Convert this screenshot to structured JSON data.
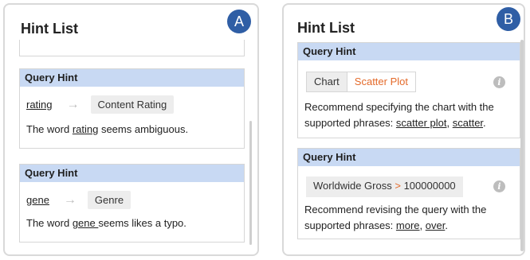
{
  "panel_a": {
    "title": "Hint List",
    "badge": "A",
    "hints": [
      {
        "header": "Query Hint",
        "term": "rating",
        "replacement": "Content Rating",
        "msg_prefix": "The word ",
        "msg_term": "rating",
        "msg_suffix": " seems ambiguous."
      },
      {
        "header": "Query Hint",
        "term": "gene",
        "replacement": "Genre",
        "msg_prefix": "The word ",
        "msg_term": "gene ",
        "msg_suffix": "seems likes a typo."
      }
    ]
  },
  "panel_b": {
    "title": "Hint List",
    "badge": "B",
    "hints": [
      {
        "header": "Query Hint",
        "field": "Chart",
        "value": "Scatter Plot",
        "line1": "Recommend specifying the chart with the",
        "line2_prefix": "supported phrases: ",
        "phrase1": "scatter plot",
        "sep": ", ",
        "phrase2": "scatter",
        "end": "."
      },
      {
        "header": "Query Hint",
        "field": "Worldwide Gross",
        "operator": ">",
        "value": "100000000",
        "line1": "Recommend revising the query with the",
        "line2_prefix": "supported phrases: ",
        "phrase1": "more",
        "sep": ", ",
        "phrase2": "over",
        "end": "."
      }
    ]
  },
  "icons": {
    "arrow": "→",
    "info": "i"
  },
  "colors": {
    "header_bg": "#c8d9f3",
    "badge_bg": "#2f5ea5",
    "accent_orange": "#e46a2a"
  }
}
